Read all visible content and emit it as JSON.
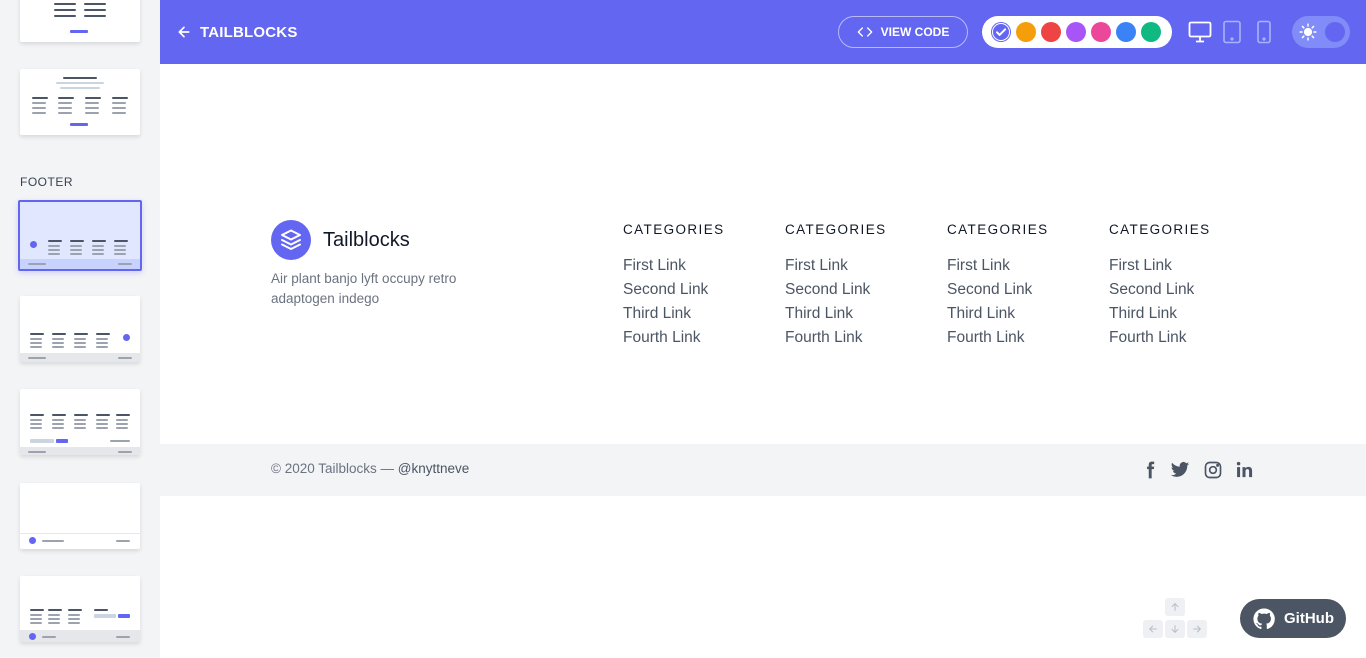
{
  "header": {
    "title": "TAILBLOCKS",
    "view_code_label": "VIEW CODE",
    "palette": [
      {
        "name": "indigo",
        "color": "#6366f1",
        "selected": true
      },
      {
        "name": "yellow",
        "color": "#f59e0b",
        "selected": false
      },
      {
        "name": "red",
        "color": "#ef4444",
        "selected": false
      },
      {
        "name": "purple",
        "color": "#a855f7",
        "selected": false
      },
      {
        "name": "pink",
        "color": "#ec4899",
        "selected": false
      },
      {
        "name": "blue",
        "color": "#3b82f6",
        "selected": false
      },
      {
        "name": "green",
        "color": "#10b981",
        "selected": false
      }
    ],
    "devices": [
      "desktop-icon",
      "tablet-icon",
      "phone-icon"
    ],
    "theme_toggle": "sun-icon"
  },
  "sidebar": {
    "section_label": "FOOTER"
  },
  "footer_block": {
    "brand_name": "Tailblocks",
    "brand_description": "Air plant banjo lyft occupy retro adaptogen indego",
    "columns": [
      {
        "title": "CATEGORIES",
        "links": [
          "First Link",
          "Second Link",
          "Third Link",
          "Fourth Link"
        ]
      },
      {
        "title": "CATEGORIES",
        "links": [
          "First Link",
          "Second Link",
          "Third Link",
          "Fourth Link"
        ]
      },
      {
        "title": "CATEGORIES",
        "links": [
          "First Link",
          "Second Link",
          "Third Link",
          "Fourth Link"
        ]
      },
      {
        "title": "CATEGORIES",
        "links": [
          "First Link",
          "Second Link",
          "Third Link",
          "Fourth Link"
        ]
      }
    ],
    "copyright": "© 2020 Tailblocks —",
    "handle": "@knyttneve",
    "social_icons": [
      "facebook-icon",
      "twitter-icon",
      "instagram-icon",
      "linkedin-icon"
    ]
  },
  "github_button": {
    "label": "GitHub"
  },
  "colors": {
    "accent": "#6366f1"
  }
}
